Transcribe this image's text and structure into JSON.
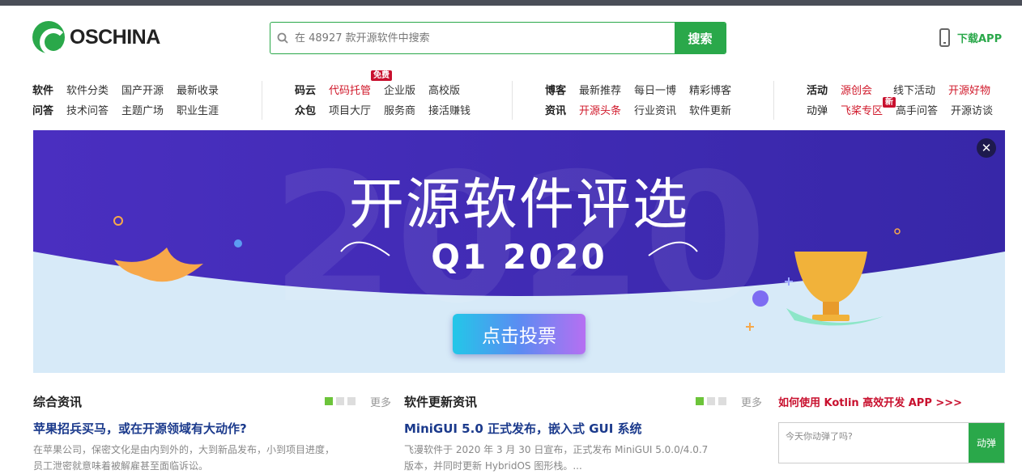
{
  "header": {
    "logo_text": "OSCHINA",
    "search_placeholder": "在 48927 款开源软件中搜索",
    "search_button": "搜索",
    "download_app": "下载APP"
  },
  "nav": {
    "group1": {
      "row1": {
        "key": "软件",
        "items": [
          "软件分类",
          "国产开源",
          "最新收录"
        ]
      },
      "row2": {
        "key": "问答",
        "items": [
          "技术问答",
          "主题广场",
          "职业生涯"
        ]
      }
    },
    "group2": {
      "row1": {
        "key": "码云",
        "items": [
          "代码托管",
          "企业版",
          "高校版"
        ],
        "tag": "免费"
      },
      "row2": {
        "key": "众包",
        "items": [
          "项目大厅",
          "服务商",
          "接活赚钱"
        ]
      }
    },
    "group3": {
      "row1": {
        "key": "博客",
        "items": [
          "最新推荐",
          "每日一博",
          "精彩博客"
        ]
      },
      "row2": {
        "key": "资讯",
        "items": [
          "开源头条",
          "行业资讯",
          "软件更新"
        ]
      }
    },
    "group4": {
      "row1": {
        "key": "活动",
        "items": [
          "源创会",
          "线下活动",
          "开源好物"
        ]
      },
      "row2": {
        "key": "动弹",
        "items": [
          "飞桨专区",
          "高手问答",
          "开源访谈"
        ],
        "tag": "新"
      }
    },
    "colors": {
      "accent": "#2aa84a",
      "highlight": "#d0182a"
    }
  },
  "banner": {
    "title": "开源软件评选",
    "subtitle": "Q1 2020",
    "background_text": "2020",
    "vote_button": "点击投票",
    "close_icon": "close-icon"
  },
  "columns": {
    "news": {
      "title": "综合资讯",
      "more": "更多",
      "article_title": "苹果招兵买马，或在开源领域有大动作?",
      "article_desc1": "在苹果公司，保密文化是由内到外的，大到新品发布，小到项目进度，",
      "article_desc2": "员工泄密就意味着被解雇甚至面临诉讼。"
    },
    "software": {
      "title": "软件更新资讯",
      "more": "更多",
      "article_title": "MiniGUI 5.0 正式发布，嵌入式 GUI 系统",
      "article_desc1": "飞漫软件于 2020 年 3 月 30 日宣布，正式发布 MiniGUI 5.0.0/4.0.7",
      "article_desc2": "版本，并同时更新 HybridOS 图形栈。..."
    },
    "side": {
      "kotlin_link": "如何使用 Kotlin 高效开发 APP >>>",
      "tweet_placeholder": "今天你动弹了吗?",
      "tweet_button": "动弹"
    }
  }
}
